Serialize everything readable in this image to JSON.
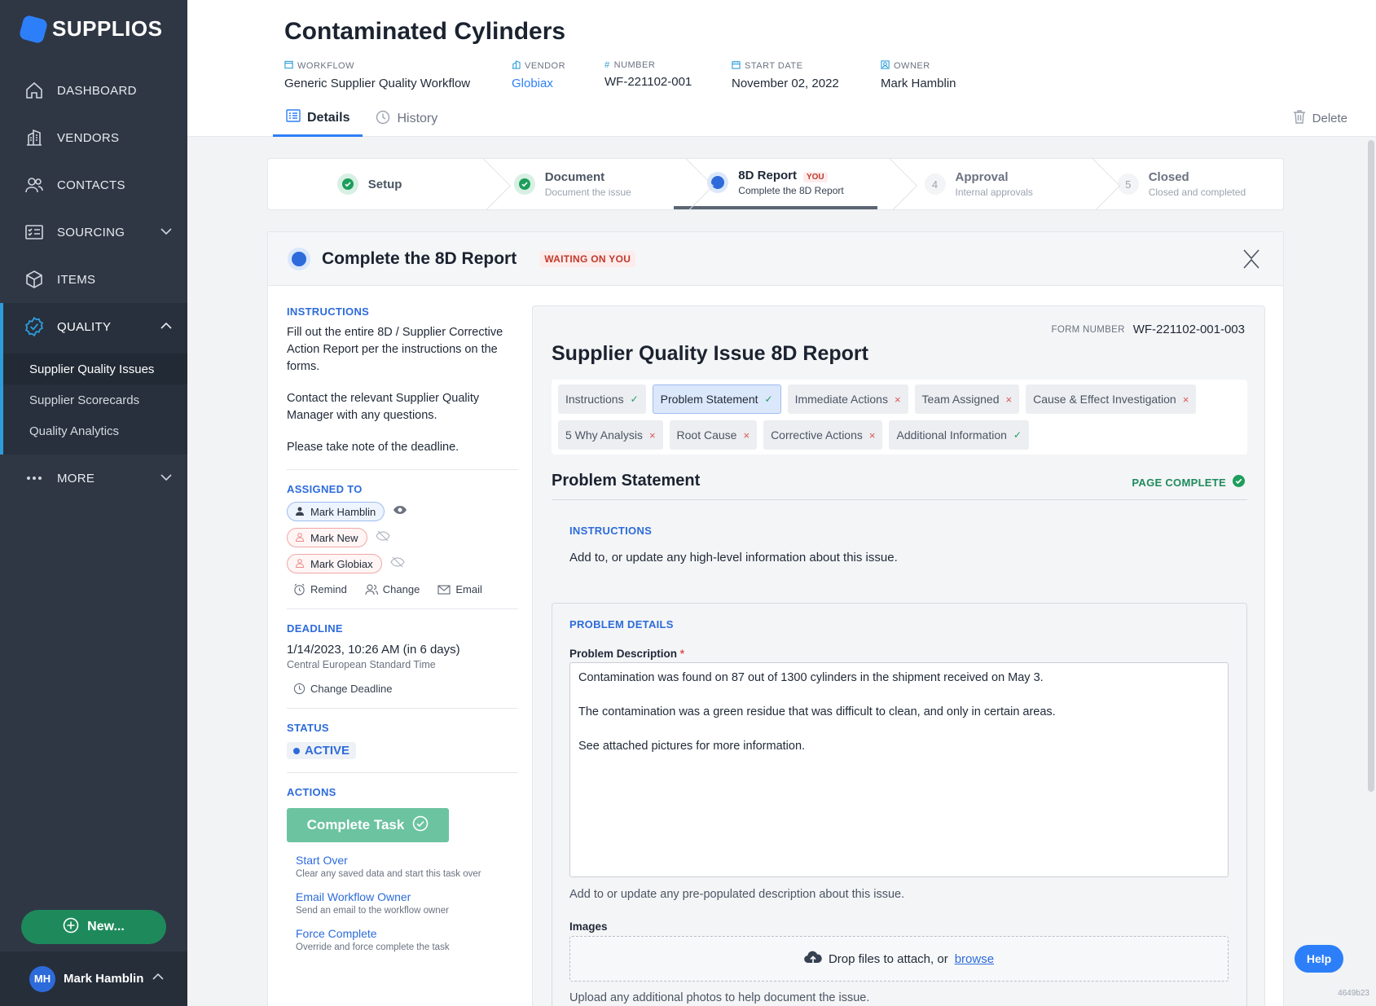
{
  "app": {
    "logo": "SUPPLIOS"
  },
  "sidebar": {
    "items": [
      {
        "label": "DASHBOARD",
        "icon": "home-icon"
      },
      {
        "label": "VENDORS",
        "icon": "building-icon"
      },
      {
        "label": "CONTACTS",
        "icon": "users-icon"
      },
      {
        "label": "SOURCING",
        "icon": "checklist-icon"
      },
      {
        "label": "ITEMS",
        "icon": "box-icon"
      },
      {
        "label": "QUALITY",
        "icon": "badge-check-icon"
      }
    ],
    "quality_sub": [
      "Supplier Quality Issues",
      "Supplier Scorecards",
      "Quality Analytics"
    ],
    "more": "MORE",
    "new_button": "New...",
    "user": {
      "initials": "MH",
      "name": "Mark Hamblin"
    }
  },
  "header": {
    "title": "Contaminated Cylinders",
    "meta": [
      {
        "label": "WORKFLOW",
        "value": "Generic Supplier Quality Workflow"
      },
      {
        "label": "VENDOR",
        "value": "Globiax"
      },
      {
        "label": "NUMBER",
        "value": "WF-221102-001"
      },
      {
        "label": "START DATE",
        "value": "November 02, 2022"
      },
      {
        "label": "OWNER",
        "value": "Mark Hamblin"
      }
    ],
    "tabs": [
      "Details",
      "History"
    ],
    "delete": "Delete"
  },
  "stepper": {
    "steps": [
      {
        "name": "Setup",
        "sub": ""
      },
      {
        "name": "Document",
        "sub": "Document the issue"
      },
      {
        "name": "8D Report",
        "sub": "Complete the 8D Report",
        "badge": "YOU"
      },
      {
        "name": "Approval",
        "sub": "Internal approvals",
        "num": "4"
      },
      {
        "name": "Closed",
        "sub": "Closed and completed",
        "num": "5"
      }
    ]
  },
  "task": {
    "title": "Complete the 8D Report",
    "badge": "WAITING ON YOU",
    "instructions_label": "INSTRUCTIONS",
    "instructions": [
      "Fill out the entire 8D / Supplier Corrective Action Report per the instructions on the forms.",
      "Contact the relevant Supplier Quality Manager with any questions.",
      "Please take note of the deadline."
    ],
    "assigned_label": "ASSIGNED TO",
    "assignees": [
      "Mark Hamblin",
      "Mark New",
      "Mark Globiax"
    ],
    "assign_actions": [
      "Remind",
      "Change",
      "Email"
    ],
    "deadline_label": "DEADLINE",
    "deadline": "1/14/2023, 10:26 AM (in 6 days)",
    "timezone": "Central European Standard Time",
    "change_deadline": "Change Deadline",
    "status_label": "STATUS",
    "status": "ACTIVE",
    "actions_label": "ACTIONS",
    "complete_button": "Complete Task",
    "links": [
      {
        "title": "Start Over",
        "sub": "Clear any saved data and start this task over"
      },
      {
        "title": "Email Workflow Owner",
        "sub": "Send an email to the workflow owner"
      },
      {
        "title": "Force Complete",
        "sub": "Override and force complete the task"
      }
    ]
  },
  "form": {
    "number_label": "FORM NUMBER",
    "number": "WF-221102-001-003",
    "title": "Supplier Quality Issue 8D Report",
    "pages": [
      {
        "label": "Instructions",
        "state": "ok"
      },
      {
        "label": "Problem Statement",
        "state": "ok"
      },
      {
        "label": "Immediate Actions",
        "state": "no"
      },
      {
        "label": "Team Assigned",
        "state": "no"
      },
      {
        "label": "Cause & Effect Investigation",
        "state": "no"
      },
      {
        "label": "5 Why Analysis",
        "state": "no"
      },
      {
        "label": "Root Cause",
        "state": "no"
      },
      {
        "label": "Corrective Actions",
        "state": "no"
      },
      {
        "label": "Additional Information",
        "state": "ok"
      }
    ],
    "section_title": "Problem Statement",
    "page_complete": "PAGE COMPLETE",
    "instructions_label": "INSTRUCTIONS",
    "instructions_text": "Add to, or update any high-level information about this issue.",
    "details_label": "PROBLEM DETAILS",
    "description_label": "Problem Description",
    "description_lines": [
      "Contamination was found on 87 out of 1300 cylinders in the shipment received on May 3.",
      "The contamination was a green residue that was difficult to clean, and only in certain areas.",
      "See attached pictures for more information."
    ],
    "description_help": "Add to or update any pre-populated description about this issue.",
    "images_label": "Images",
    "drop_text": "Drop files to attach, or",
    "browse": "browse",
    "images_help": "Upload any additional photos to help document the issue."
  },
  "help": "Help",
  "build": "4649b23",
  "colors": {
    "accent": "#2d7ff9",
    "sidebar": "#2f3744",
    "success": "#1e8a5c",
    "danger": "#e05252"
  }
}
